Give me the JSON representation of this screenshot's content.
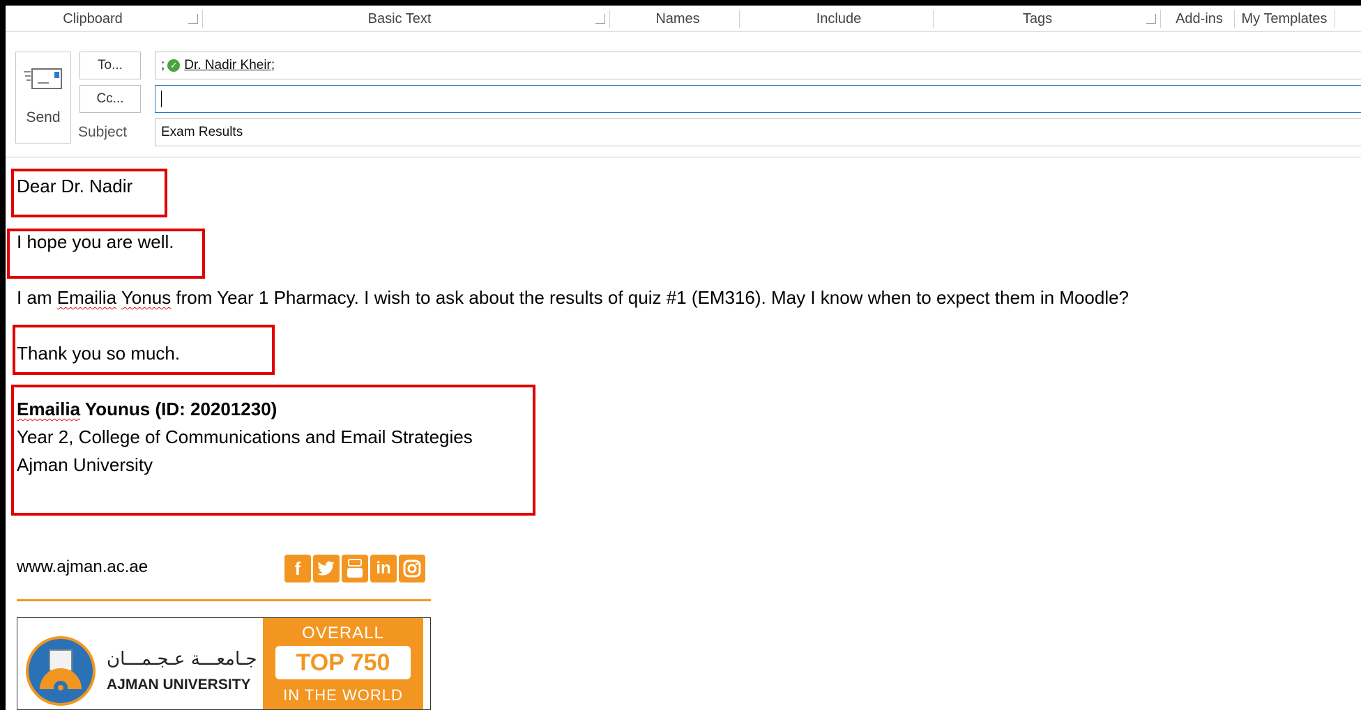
{
  "ribbon": {
    "groups": [
      "Clipboard",
      "Basic Text",
      "Names",
      "Include",
      "Tags",
      "Add-ins",
      "My Templates"
    ]
  },
  "header": {
    "send_label": "Send",
    "to_label": "To...",
    "cc_label": "Cc...",
    "subject_label": "Subject",
    "to_prefix": ";",
    "to_recipient": "Dr. Nadir Kheir",
    "to_suffix": ";",
    "cc_value": "",
    "subject_value": "Exam Results"
  },
  "body": {
    "greeting": "Dear Dr. Nadir",
    "line1": "I hope you are well.",
    "line2_part1": "I am ",
    "line2_name1": "Emailia",
    "line2_space": " ",
    "line2_name2": "Yonus",
    "line2_part2": " from Year 1 Pharmacy. I wish to ask about the results of quiz #1 (EM316). May I know when to expect them in Moodle?",
    "closing": "Thank you so  much.",
    "sig_name_a": "Emailia",
    "sig_name_b": " Younus (ID: 20201230)",
    "sig_line2": "Year 2, College of Communications and Email Strategies",
    "sig_line3": "Ajman University"
  },
  "signature_block": {
    "website": "www.ajman.ac.ae",
    "social_icons": [
      "facebook-icon",
      "twitter-icon",
      "youtube-icon",
      "linkedin-icon",
      "instagram-icon"
    ],
    "arabic_name": "جـامعـــة عـجـمـــان",
    "university_name": "AJMAN UNIVERSITY",
    "rank_top": "OVERALL",
    "rank_mid": "TOP 750",
    "rank_bottom": "IN THE WORLD"
  },
  "colors": {
    "highlight": "#e00000",
    "brand_orange": "#f39621",
    "brand_blue": "#2a72b5"
  }
}
